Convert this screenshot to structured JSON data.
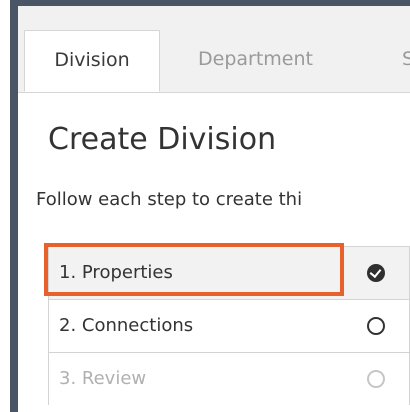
{
  "tabs": [
    {
      "label": "Division"
    },
    {
      "label": "Department"
    },
    {
      "label": "S"
    }
  ],
  "page": {
    "title": "Create Division",
    "subtitle": "Follow each step to create thi"
  },
  "steps": [
    {
      "label": "1. Properties",
      "status": "complete",
      "icon": "check-circle-icon"
    },
    {
      "label": "2. Connections",
      "status": "pending",
      "icon": "empty-circle-icon"
    },
    {
      "label": "3. Review",
      "status": "disabled",
      "icon": "empty-circle-icon"
    }
  ],
  "colors": {
    "highlight": "#e8612c",
    "frame": "#4a5566"
  }
}
